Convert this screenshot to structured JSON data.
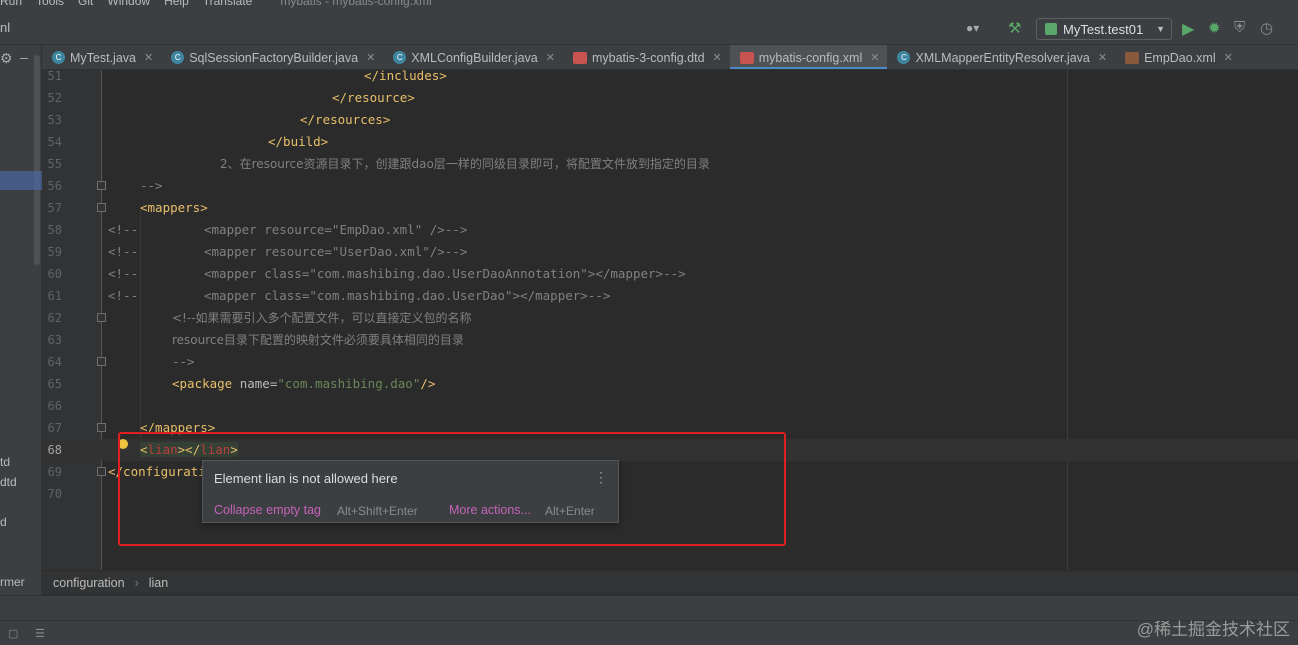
{
  "menubar": {
    "items": [
      "Run",
      "Tools",
      "Git",
      "Window",
      "Help",
      "Translate"
    ],
    "window_title": "mybatis - mybatis-config.xml"
  },
  "toolbar": {
    "left_stub": "nl",
    "run_config": "MyTest.test01"
  },
  "leftstrip": {
    "fragments": [
      "td",
      "dtd",
      "d",
      "rmer"
    ]
  },
  "tabs": [
    {
      "label": "MyTest.java",
      "icon": "java-class-icon",
      "kind": "java",
      "active": false
    },
    {
      "label": "SqlSessionFactoryBuilder.java",
      "icon": "java-class-icon",
      "kind": "java",
      "active": false
    },
    {
      "label": "XMLConfigBuilder.java",
      "icon": "java-class-icon",
      "kind": "java",
      "active": false
    },
    {
      "label": "mybatis-3-config.dtd",
      "icon": "dtd-file-icon",
      "kind": "dtd",
      "active": false
    },
    {
      "label": "mybatis-config.xml",
      "icon": "xml-file-icon",
      "kind": "xml",
      "active": true
    },
    {
      "label": "XMLMapperEntityResolver.java",
      "icon": "java-class-icon",
      "kind": "java",
      "active": false
    },
    {
      "label": "EmpDao.xml",
      "icon": "xml-file-icon",
      "kind": "xmlfile",
      "active": false
    }
  ],
  "editor": {
    "current_line": "68",
    "lines": [
      {
        "n": "51",
        "text": "</includes>"
      },
      {
        "n": "52",
        "text": "</resource>"
      },
      {
        "n": "53",
        "text": "</resources>"
      },
      {
        "n": "54",
        "text": "</build>"
      },
      {
        "n": "55",
        "text": "2、在resource资源目录下，创建跟dao层一样的同级目录即可，将配置文件放到指定的目录"
      },
      {
        "n": "56",
        "text": "-->"
      },
      {
        "n": "57",
        "text": "<mappers>"
      },
      {
        "n": "58",
        "prefix": "<!--",
        "text": "<mapper resource=\"EmpDao.xml\" />-->"
      },
      {
        "n": "59",
        "prefix": "<!--",
        "text": "<mapper resource=\"UserDao.xml\"/>-->"
      },
      {
        "n": "60",
        "prefix": "<!--",
        "text": "<mapper class=\"com.mashibing.dao.UserDaoAnnotation\"></mapper>-->"
      },
      {
        "n": "61",
        "prefix": "<!--",
        "text": "<mapper class=\"com.mashibing.dao.UserDao\"></mapper>-->"
      },
      {
        "n": "62",
        "text": "<!--如果需要引入多个配置文件，可以直接定义包的名称"
      },
      {
        "n": "63",
        "text": "resource目录下配置的映射文件必须要具体相同的目录"
      },
      {
        "n": "64",
        "text": "-->"
      },
      {
        "n": "65",
        "tag_open": "<package ",
        "attr": "name=",
        "value": "\"com.mashibing.dao\"",
        "tag_close": "/>"
      },
      {
        "n": "66",
        "text": ""
      },
      {
        "n": "67",
        "text": "</mappers>"
      },
      {
        "n": "68",
        "lt": "<",
        "name1": "lian",
        "mid": "></",
        "name2": "lian",
        "gt": ">"
      },
      {
        "n": "69",
        "text": "</configuration>"
      },
      {
        "n": "70",
        "text": ""
      }
    ]
  },
  "popup": {
    "message": "Element lian is not allowed here",
    "action1": "Collapse empty tag",
    "shortcut1": "Alt+Shift+Enter",
    "action2": "More actions...",
    "shortcut2": "Alt+Enter"
  },
  "breadcrumb": {
    "items": [
      "configuration",
      "lian"
    ],
    "left_stub": "rmer"
  },
  "watermark": "@稀土掘金技术社区",
  "colors": {
    "background": "#2b2b2b",
    "tag": "#e8bf6a",
    "comment": "#808080",
    "string": "#6a8759",
    "error": "#bc3f3c",
    "highlight_box": "#e02020",
    "action_link": "#c563b8"
  }
}
